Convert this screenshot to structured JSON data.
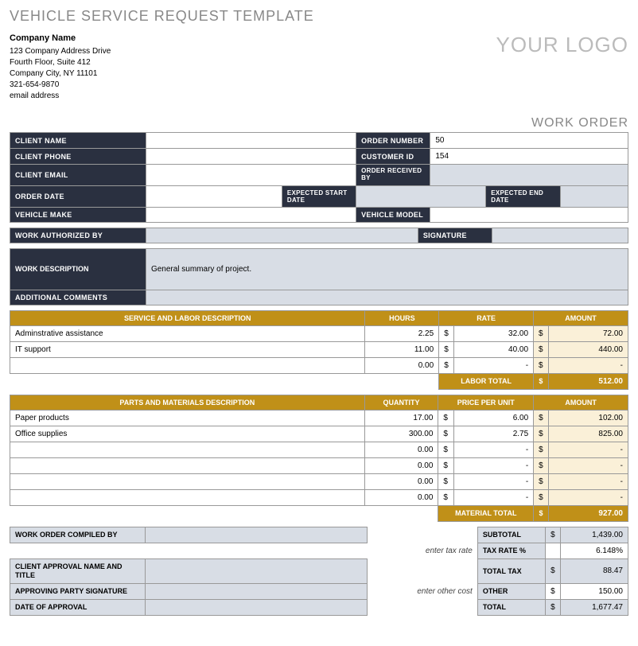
{
  "title": "VEHICLE SERVICE REQUEST TEMPLATE",
  "company": {
    "name": "Company Name",
    "addr1": "123 Company Address Drive",
    "addr2": "Fourth Floor, Suite 412",
    "addr3": "Company City, NY  11101",
    "phone": "321-654-9870",
    "email": "email address"
  },
  "logo": "YOUR LOGO",
  "work_order_label": "WORK ORDER",
  "labels": {
    "client_name": "CLIENT NAME",
    "client_phone": "CLIENT PHONE",
    "client_email": "CLIENT EMAIL",
    "order_date": "ORDER DATE",
    "vehicle_make": "VEHICLE MAKE",
    "order_number": "ORDER NUMBER",
    "customer_id": "CUSTOMER ID",
    "order_received_by": "ORDER RECEIVED BY",
    "expected_start": "EXPECTED START DATE",
    "expected_end": "EXPECTED END DATE",
    "vehicle_model": "VEHICLE MODEL",
    "work_auth": "WORK AUTHORIZED BY",
    "signature": "SIGNATURE",
    "work_desc": "WORK DESCRIPTION",
    "add_comments": "ADDITIONAL COMMENTS",
    "compiled_by": "WORK ORDER COMPILED BY",
    "client_approval": "CLIENT APPROVAL NAME AND TITLE",
    "approving_sig": "APPROVING PARTY SIGNATURE",
    "date_approval": "DATE OF APPROVAL",
    "subtotal": "SUBTOTAL",
    "tax_rate": "TAX RATE %",
    "total_tax": "TOTAL TAX",
    "other": "OTHER",
    "total": "TOTAL",
    "enter_tax": "enter tax rate",
    "enter_other": "enter other cost"
  },
  "values": {
    "order_number": "50",
    "customer_id": "154",
    "work_desc": "General summary of project."
  },
  "service": {
    "headers": {
      "desc": "SERVICE AND LABOR DESCRIPTION",
      "hours": "HOURS",
      "rate": "RATE",
      "amount": "AMOUNT"
    },
    "rows": [
      {
        "desc": "Adminstrative assistance",
        "hours": "2.25",
        "rate": "32.00",
        "amount": "72.00"
      },
      {
        "desc": "IT support",
        "hours": "11.00",
        "rate": "40.00",
        "amount": "440.00"
      },
      {
        "desc": "",
        "hours": "0.00",
        "rate": "-",
        "amount": "-"
      }
    ],
    "total_label": "LABOR TOTAL",
    "total": "512.00"
  },
  "parts": {
    "headers": {
      "desc": "PARTS AND MATERIALS DESCRIPTION",
      "qty": "QUANTITY",
      "ppu": "PRICE PER UNIT",
      "amount": "AMOUNT"
    },
    "rows": [
      {
        "desc": "Paper products",
        "qty": "17.00",
        "ppu": "6.00",
        "amount": "102.00"
      },
      {
        "desc": "Office supplies",
        "qty": "300.00",
        "ppu": "2.75",
        "amount": "825.00"
      },
      {
        "desc": "",
        "qty": "0.00",
        "ppu": "-",
        "amount": "-"
      },
      {
        "desc": "",
        "qty": "0.00",
        "ppu": "-",
        "amount": "-"
      },
      {
        "desc": "",
        "qty": "0.00",
        "ppu": "-",
        "amount": "-"
      },
      {
        "desc": "",
        "qty": "0.00",
        "ppu": "-",
        "amount": "-"
      }
    ],
    "total_label": "MATERIAL TOTAL",
    "total": "927.00"
  },
  "totals": {
    "subtotal": "1,439.00",
    "tax_rate": "6.148%",
    "total_tax": "88.47",
    "other": "150.00",
    "total": "1,677.47"
  },
  "currency": "$"
}
